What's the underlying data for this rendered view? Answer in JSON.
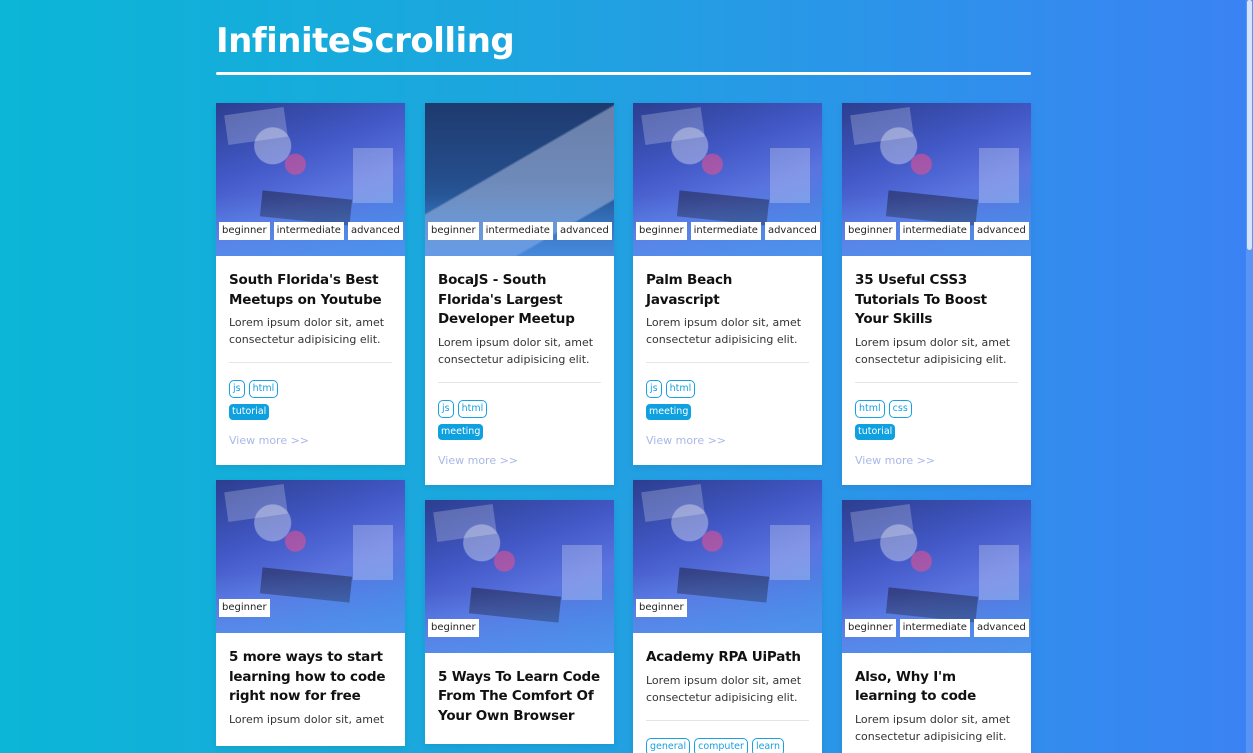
{
  "app": {
    "title": "InfiniteScrolling"
  },
  "columns": [
    {
      "cards": [
        {
          "image": "desk-setup",
          "levels": [
            "beginner",
            "intermediate",
            "advanced"
          ],
          "title": "South Florida's Best Meetups on Youtube",
          "description": "Lorem ipsum dolor sit, amet consectetur adipisicing elit.",
          "tags": [
            "js",
            "html"
          ],
          "categories": [
            "tutorial"
          ],
          "view_more": "View more >>"
        },
        {
          "image": "desk-setup",
          "levels": [
            "beginner"
          ],
          "title": "5 more ways to start learning how to code right now for free",
          "description": "Lorem ipsum dolor sit, amet",
          "tags": [],
          "categories": [],
          "view_more": ""
        }
      ]
    },
    {
      "cards": [
        {
          "image": "laptop",
          "levels": [
            "beginner",
            "intermediate",
            "advanced"
          ],
          "title": "BocaJS - South Florida's Largest Developer Meetup",
          "description": "Lorem ipsum dolor sit, amet consectetur adipisicing elit.",
          "tags": [
            "js",
            "html"
          ],
          "categories": [
            "meeting"
          ],
          "view_more": "View more >>"
        },
        {
          "image": "desk-setup",
          "levels": [
            "beginner"
          ],
          "title": "5 Ways To Learn Code From The Comfort Of Your Own Browser",
          "description": "",
          "tags": [],
          "categories": [],
          "view_more": ""
        }
      ]
    },
    {
      "cards": [
        {
          "image": "desk-setup",
          "levels": [
            "beginner",
            "intermediate",
            "advanced"
          ],
          "title": "Palm Beach Javascript",
          "description": "Lorem ipsum dolor sit, amet consectetur adipisicing elit.",
          "tags": [
            "js",
            "html"
          ],
          "categories": [
            "meeting"
          ],
          "view_more": "View more >>"
        },
        {
          "image": "desk-setup",
          "levels": [
            "beginner"
          ],
          "title": "Academy RPA UiPath",
          "description": "Lorem ipsum dolor sit, amet consectetur adipisicing elit.",
          "tags": [
            "general",
            "computer",
            "learn"
          ],
          "categories": [],
          "view_more": ""
        }
      ]
    },
    {
      "cards": [
        {
          "image": "desk-setup",
          "levels": [
            "beginner",
            "intermediate",
            "advanced"
          ],
          "title": "35 Useful CSS3 Tutorials To Boost Your Skills",
          "description": "Lorem ipsum dolor sit, amet consectetur adipisicing elit.",
          "tags": [
            "html",
            "css"
          ],
          "categories": [
            "tutorial"
          ],
          "view_more": "View more >>"
        },
        {
          "image": "desk-setup",
          "levels": [
            "beginner",
            "intermediate",
            "advanced"
          ],
          "title": "Also, Why I'm learning to code",
          "description": "Lorem ipsum dolor sit, amet consectetur adipisicing elit.",
          "tags": [],
          "categories": [],
          "view_more": ""
        }
      ]
    }
  ]
}
